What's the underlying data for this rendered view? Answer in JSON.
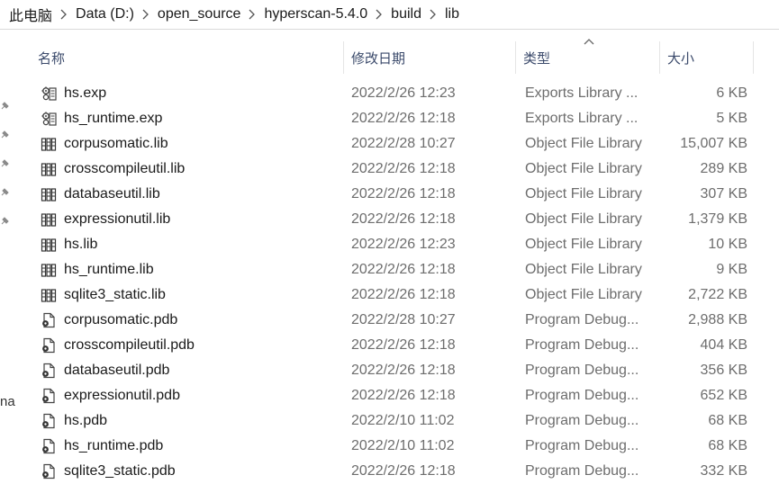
{
  "breadcrumb": [
    "此电脑",
    "Data (D:)",
    "open_source",
    "hyperscan-5.4.0",
    "build",
    "lib"
  ],
  "headers": {
    "name": "名称",
    "date": "修改日期",
    "type": "类型",
    "size": "大小"
  },
  "nav_partial_text": "na",
  "files": [
    {
      "name": "hs.exp",
      "date": "2022/2/26 12:23",
      "type": "Exports Library ...",
      "size": "6 KB",
      "icon": "exports-file-icon"
    },
    {
      "name": "hs_runtime.exp",
      "date": "2022/2/26 12:18",
      "type": "Exports Library ...",
      "size": "5 KB",
      "icon": "exports-file-icon"
    },
    {
      "name": "corpusomatic.lib",
      "date": "2022/2/28 10:27",
      "type": "Object File Library",
      "size": "15,007 KB",
      "icon": "library-file-icon"
    },
    {
      "name": "crosscompileutil.lib",
      "date": "2022/2/26 12:18",
      "type": "Object File Library",
      "size": "289 KB",
      "icon": "library-file-icon"
    },
    {
      "name": "databaseutil.lib",
      "date": "2022/2/26 12:18",
      "type": "Object File Library",
      "size": "307 KB",
      "icon": "library-file-icon"
    },
    {
      "name": "expressionutil.lib",
      "date": "2022/2/26 12:18",
      "type": "Object File Library",
      "size": "1,379 KB",
      "icon": "library-file-icon"
    },
    {
      "name": "hs.lib",
      "date": "2022/2/26 12:23",
      "type": "Object File Library",
      "size": "10 KB",
      "icon": "library-file-icon"
    },
    {
      "name": "hs_runtime.lib",
      "date": "2022/2/26 12:18",
      "type": "Object File Library",
      "size": "9 KB",
      "icon": "library-file-icon"
    },
    {
      "name": "sqlite3_static.lib",
      "date": "2022/2/26 12:18",
      "type": "Object File Library",
      "size": "2,722 KB",
      "icon": "library-file-icon"
    },
    {
      "name": "corpusomatic.pdb",
      "date": "2022/2/28 10:27",
      "type": "Program Debug...",
      "size": "2,988 KB",
      "icon": "pdb-file-icon"
    },
    {
      "name": "crosscompileutil.pdb",
      "date": "2022/2/26 12:18",
      "type": "Program Debug...",
      "size": "404 KB",
      "icon": "pdb-file-icon"
    },
    {
      "name": "databaseutil.pdb",
      "date": "2022/2/26 12:18",
      "type": "Program Debug...",
      "size": "356 KB",
      "icon": "pdb-file-icon"
    },
    {
      "name": "expressionutil.pdb",
      "date": "2022/2/26 12:18",
      "type": "Program Debug...",
      "size": "652 KB",
      "icon": "pdb-file-icon"
    },
    {
      "name": "hs.pdb",
      "date": "2022/2/10 11:02",
      "type": "Program Debug...",
      "size": "68 KB",
      "icon": "pdb-file-icon"
    },
    {
      "name": "hs_runtime.pdb",
      "date": "2022/2/10 11:02",
      "type": "Program Debug...",
      "size": "68 KB",
      "icon": "pdb-file-icon"
    },
    {
      "name": "sqlite3_static.pdb",
      "date": "2022/2/26 12:18",
      "type": "Program Debug...",
      "size": "332 KB",
      "icon": "pdb-file-icon"
    }
  ]
}
